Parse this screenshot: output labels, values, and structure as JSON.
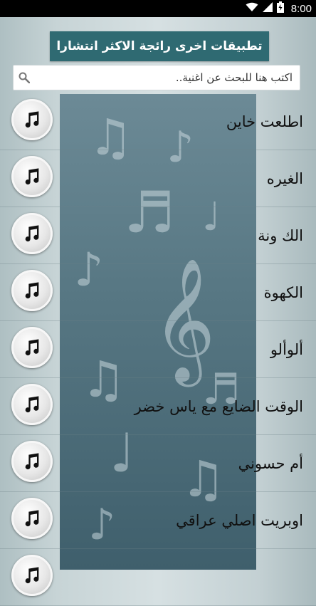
{
  "status_bar": {
    "time": "8:00",
    "icons": [
      "wifi-icon",
      "signal-icon",
      "battery-icon"
    ]
  },
  "promo": {
    "label": "تطبيقات اخرى رائجة الاكثر انتشارا"
  },
  "search": {
    "placeholder": "اكتب هنا للبحث عن اغنية..",
    "icon": "search-icon"
  },
  "songs": [
    {
      "title": "اطلعت خاين"
    },
    {
      "title": "الغيره"
    },
    {
      "title": "الك ونة"
    },
    {
      "title": "الكهوة"
    },
    {
      "title": "ألوألو"
    },
    {
      "title": "الوقت الضايع  مع ياس خضر"
    },
    {
      "title": "أم حسوني"
    },
    {
      "title": "اوبريت اصلي عراقي"
    }
  ],
  "colors": {
    "banner": "#2f6a72",
    "status_bar": "#000000",
    "panel": "#587884"
  }
}
